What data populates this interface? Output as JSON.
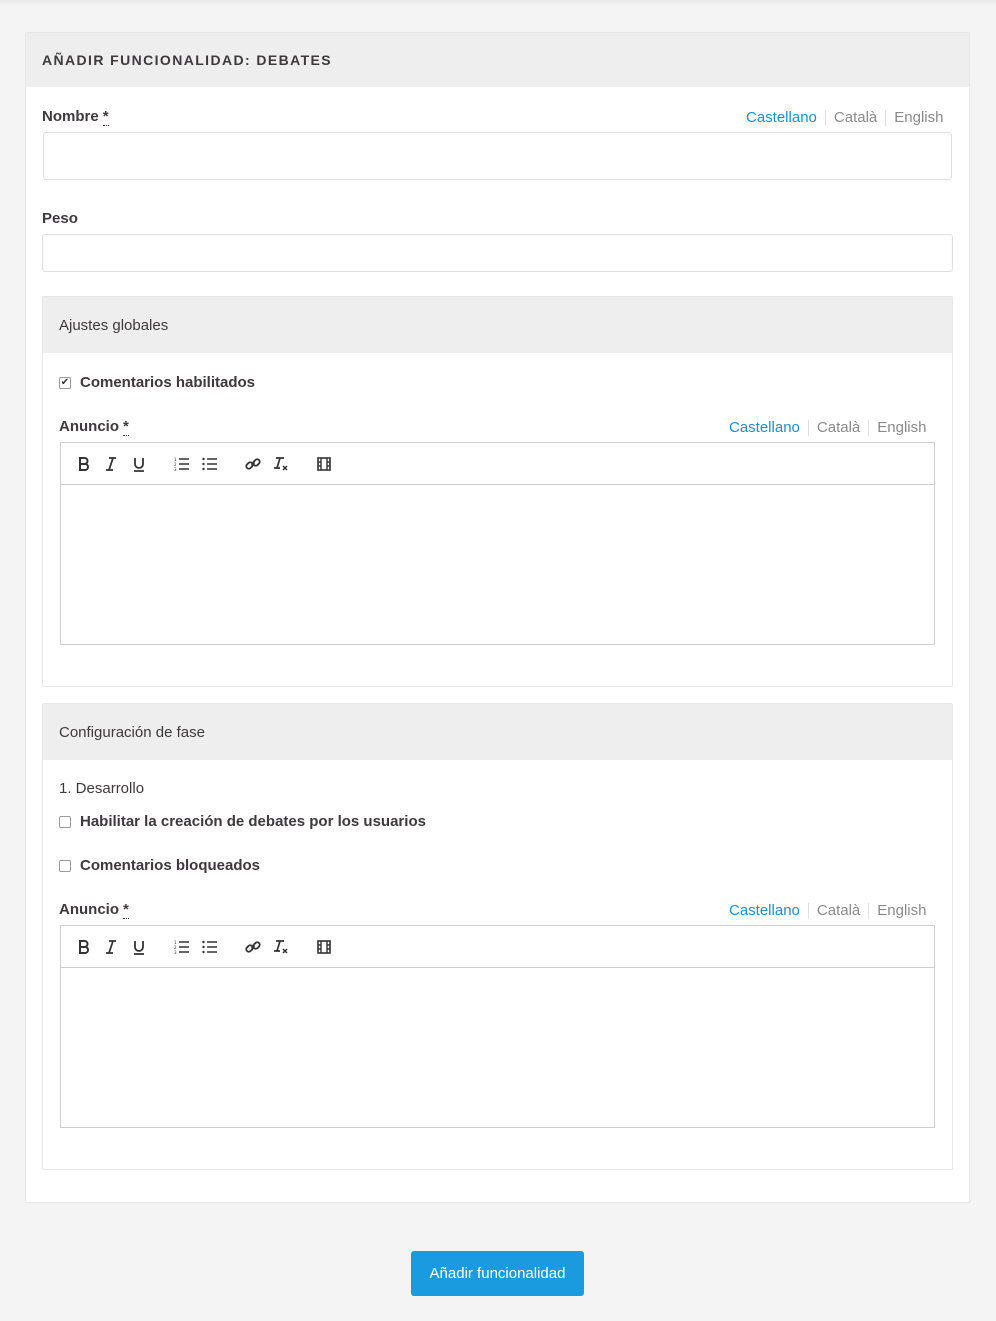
{
  "page": {
    "title": "AÑADIR FUNCIONALIDAD: DEBATES",
    "submit_label": "Añadir funcionalidad"
  },
  "languages": [
    "Castellano",
    "Català",
    "English"
  ],
  "fields": {
    "nombre": {
      "label": "Nombre",
      "required_mark": "*",
      "value": ""
    },
    "peso": {
      "label": "Peso",
      "value": ""
    }
  },
  "global_settings": {
    "title": "Ajustes globales",
    "comments_enabled": {
      "label": "Comentarios habilitados",
      "checked": true
    },
    "announcement": {
      "label": "Anuncio",
      "required_mark": "*"
    }
  },
  "phase_settings": {
    "title": "Configuración de fase",
    "phase_name": "1. Desarrollo",
    "enable_user_debates": {
      "label": "Habilitar la creación de debates por los usuarios",
      "checked": false
    },
    "comments_blocked": {
      "label": "Comentarios bloqueados",
      "checked": false
    },
    "announcement": {
      "label": "Anuncio",
      "required_mark": "*"
    }
  },
  "toolbar_icons": [
    "bold-icon",
    "italic-icon",
    "underline-icon",
    "ordered-list-icon",
    "bullet-list-icon",
    "link-icon",
    "clear-format-icon",
    "video-icon"
  ],
  "colors": {
    "accent": "#1a8ed6",
    "button": "#1a9be0",
    "header_bg": "#eeeeee",
    "page_bg": "#f4f4f4"
  }
}
